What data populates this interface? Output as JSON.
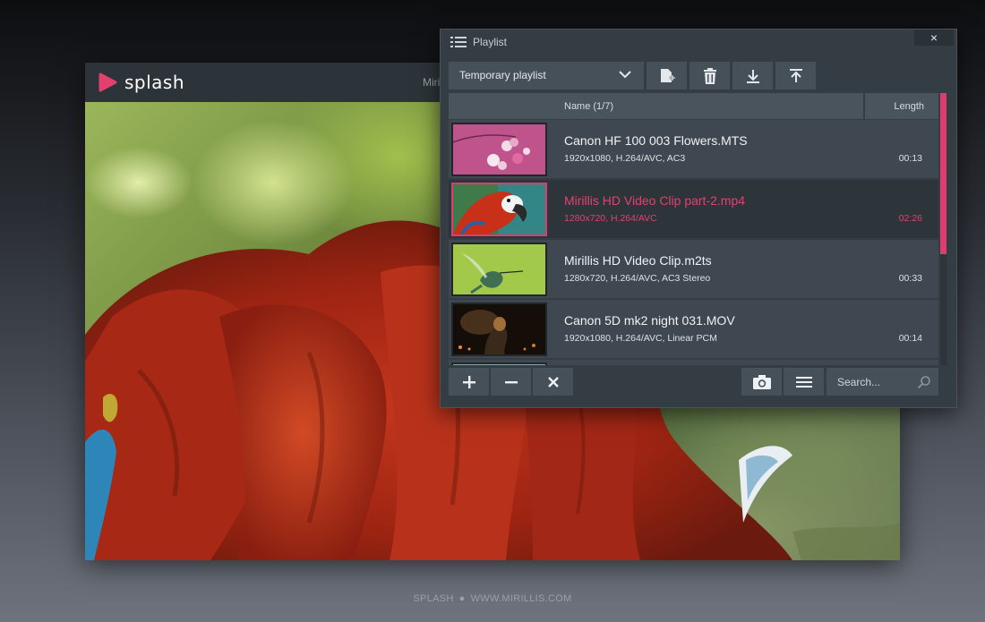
{
  "player": {
    "brand": "splash",
    "title_partial": "Miri",
    "accent_color": "#e2416f"
  },
  "playlist": {
    "window_title": "Playlist",
    "close_symbol": "×",
    "dropdown_value": "Temporary playlist",
    "toolbar_icons": [
      "add-to-playlist-icon",
      "trash-icon",
      "move-down-icon",
      "move-up-icon"
    ],
    "columns": {
      "name": "Name (1/7)",
      "length": "Length"
    },
    "items": [
      {
        "title": "Canon HF 100 003 Flowers.MTS",
        "meta": "1920x1080, H.264/AVC, AC3",
        "length": "00:13",
        "active": false
      },
      {
        "title": "Mirillis HD Video Clip part-2.mp4",
        "meta": "1280x720, H.264/AVC",
        "length": "02:26",
        "active": true
      },
      {
        "title": "Mirillis HD Video Clip.m2ts",
        "meta": "1280x720, H.264/AVC, AC3 Stereo",
        "length": "00:33",
        "active": false
      },
      {
        "title": "Canon 5D mk2 night 031.MOV",
        "meta": "1920x1080, H.264/AVC, Linear PCM",
        "length": "00:14",
        "active": false
      }
    ],
    "bottom_icons": [
      "plus-icon",
      "minus-icon",
      "close-icon",
      "camera-icon",
      "menu-icon",
      "search-icon"
    ],
    "search_placeholder": "Search..."
  },
  "footer": {
    "left": "SPLASH",
    "separator": "●",
    "right": "WWW.MIRILLIS.COM"
  }
}
